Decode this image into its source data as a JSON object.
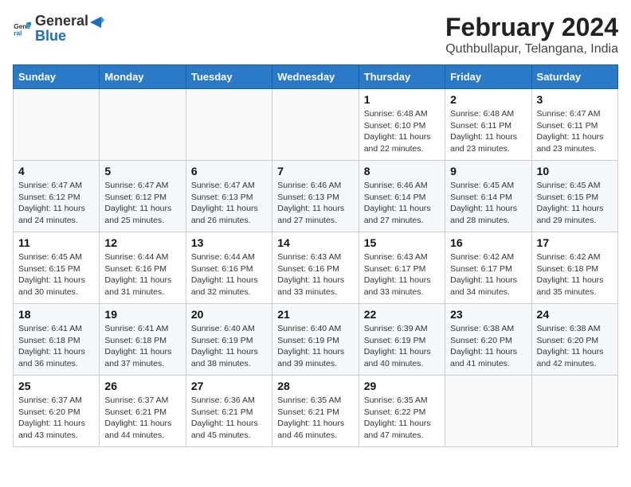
{
  "header": {
    "logo_general": "General",
    "logo_blue": "Blue",
    "title": "February 2024",
    "subtitle": "Quthbullapur, Telangana, India"
  },
  "days_of_week": [
    "Sunday",
    "Monday",
    "Tuesday",
    "Wednesday",
    "Thursday",
    "Friday",
    "Saturday"
  ],
  "weeks": [
    [
      {
        "day": "",
        "info": ""
      },
      {
        "day": "",
        "info": ""
      },
      {
        "day": "",
        "info": ""
      },
      {
        "day": "",
        "info": ""
      },
      {
        "day": "1",
        "info": "Sunrise: 6:48 AM\nSunset: 6:10 PM\nDaylight: 11 hours and 22 minutes."
      },
      {
        "day": "2",
        "info": "Sunrise: 6:48 AM\nSunset: 6:11 PM\nDaylight: 11 hours and 23 minutes."
      },
      {
        "day": "3",
        "info": "Sunrise: 6:47 AM\nSunset: 6:11 PM\nDaylight: 11 hours and 23 minutes."
      }
    ],
    [
      {
        "day": "4",
        "info": "Sunrise: 6:47 AM\nSunset: 6:12 PM\nDaylight: 11 hours and 24 minutes."
      },
      {
        "day": "5",
        "info": "Sunrise: 6:47 AM\nSunset: 6:12 PM\nDaylight: 11 hours and 25 minutes."
      },
      {
        "day": "6",
        "info": "Sunrise: 6:47 AM\nSunset: 6:13 PM\nDaylight: 11 hours and 26 minutes."
      },
      {
        "day": "7",
        "info": "Sunrise: 6:46 AM\nSunset: 6:13 PM\nDaylight: 11 hours and 27 minutes."
      },
      {
        "day": "8",
        "info": "Sunrise: 6:46 AM\nSunset: 6:14 PM\nDaylight: 11 hours and 27 minutes."
      },
      {
        "day": "9",
        "info": "Sunrise: 6:45 AM\nSunset: 6:14 PM\nDaylight: 11 hours and 28 minutes."
      },
      {
        "day": "10",
        "info": "Sunrise: 6:45 AM\nSunset: 6:15 PM\nDaylight: 11 hours and 29 minutes."
      }
    ],
    [
      {
        "day": "11",
        "info": "Sunrise: 6:45 AM\nSunset: 6:15 PM\nDaylight: 11 hours and 30 minutes."
      },
      {
        "day": "12",
        "info": "Sunrise: 6:44 AM\nSunset: 6:16 PM\nDaylight: 11 hours and 31 minutes."
      },
      {
        "day": "13",
        "info": "Sunrise: 6:44 AM\nSunset: 6:16 PM\nDaylight: 11 hours and 32 minutes."
      },
      {
        "day": "14",
        "info": "Sunrise: 6:43 AM\nSunset: 6:16 PM\nDaylight: 11 hours and 33 minutes."
      },
      {
        "day": "15",
        "info": "Sunrise: 6:43 AM\nSunset: 6:17 PM\nDaylight: 11 hours and 33 minutes."
      },
      {
        "day": "16",
        "info": "Sunrise: 6:42 AM\nSunset: 6:17 PM\nDaylight: 11 hours and 34 minutes."
      },
      {
        "day": "17",
        "info": "Sunrise: 6:42 AM\nSunset: 6:18 PM\nDaylight: 11 hours and 35 minutes."
      }
    ],
    [
      {
        "day": "18",
        "info": "Sunrise: 6:41 AM\nSunset: 6:18 PM\nDaylight: 11 hours and 36 minutes."
      },
      {
        "day": "19",
        "info": "Sunrise: 6:41 AM\nSunset: 6:18 PM\nDaylight: 11 hours and 37 minutes."
      },
      {
        "day": "20",
        "info": "Sunrise: 6:40 AM\nSunset: 6:19 PM\nDaylight: 11 hours and 38 minutes."
      },
      {
        "day": "21",
        "info": "Sunrise: 6:40 AM\nSunset: 6:19 PM\nDaylight: 11 hours and 39 minutes."
      },
      {
        "day": "22",
        "info": "Sunrise: 6:39 AM\nSunset: 6:19 PM\nDaylight: 11 hours and 40 minutes."
      },
      {
        "day": "23",
        "info": "Sunrise: 6:38 AM\nSunset: 6:20 PM\nDaylight: 11 hours and 41 minutes."
      },
      {
        "day": "24",
        "info": "Sunrise: 6:38 AM\nSunset: 6:20 PM\nDaylight: 11 hours and 42 minutes."
      }
    ],
    [
      {
        "day": "25",
        "info": "Sunrise: 6:37 AM\nSunset: 6:20 PM\nDaylight: 11 hours and 43 minutes."
      },
      {
        "day": "26",
        "info": "Sunrise: 6:37 AM\nSunset: 6:21 PM\nDaylight: 11 hours and 44 minutes."
      },
      {
        "day": "27",
        "info": "Sunrise: 6:36 AM\nSunset: 6:21 PM\nDaylight: 11 hours and 45 minutes."
      },
      {
        "day": "28",
        "info": "Sunrise: 6:35 AM\nSunset: 6:21 PM\nDaylight: 11 hours and 46 minutes."
      },
      {
        "day": "29",
        "info": "Sunrise: 6:35 AM\nSunset: 6:22 PM\nDaylight: 11 hours and 47 minutes."
      },
      {
        "day": "",
        "info": ""
      },
      {
        "day": "",
        "info": ""
      }
    ]
  ]
}
